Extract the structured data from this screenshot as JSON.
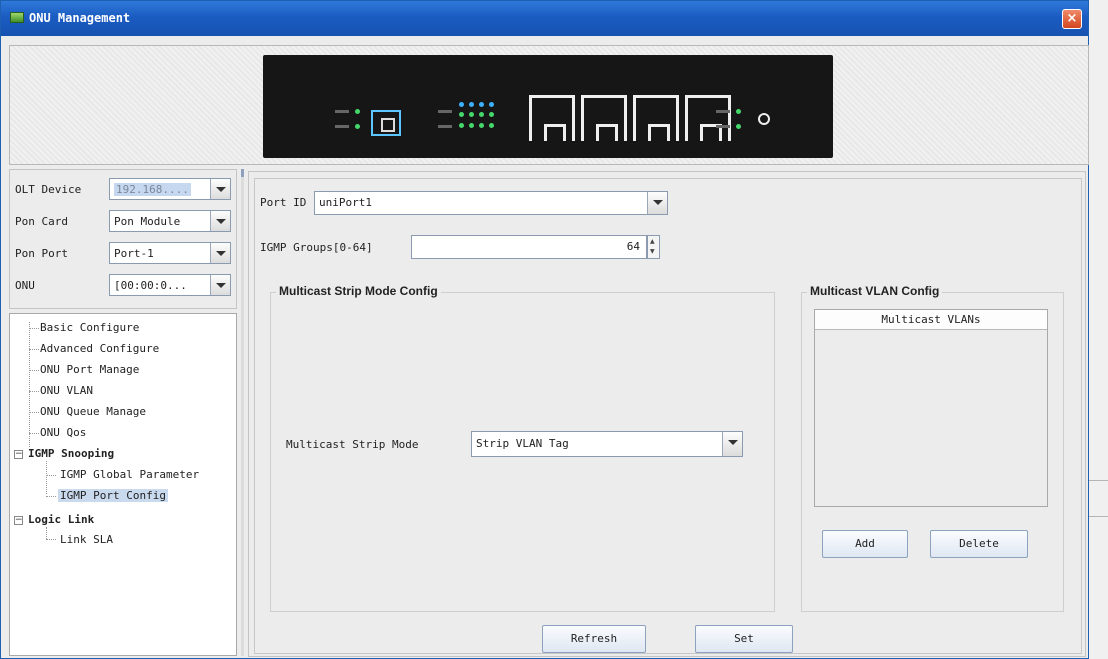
{
  "window": {
    "title": "ONU Management",
    "close_label": "×"
  },
  "left_panel": {
    "fields": [
      {
        "label": "OLT Device",
        "value": "192.168...."
      },
      {
        "label": "Pon Card",
        "value": "Pon Module"
      },
      {
        "label": "Pon Port",
        "value": "Port-1"
      },
      {
        "label": "ONU",
        "value": "[00:00:0..."
      }
    ]
  },
  "tree": {
    "items": [
      {
        "label": "Basic Configure"
      },
      {
        "label": "Advanced Configure"
      },
      {
        "label": "ONU Port Manage"
      },
      {
        "label": "ONU VLAN"
      },
      {
        "label": "ONU Queue Manage"
      },
      {
        "label": "ONU Qos"
      },
      {
        "label": "IGMP Snooping",
        "expanded": true
      },
      {
        "label": "IGMP Global Parameter"
      },
      {
        "label": "IGMP Port Config",
        "selected": true
      },
      {
        "label": "Logic Link",
        "expanded": true
      },
      {
        "label": "Link SLA"
      }
    ]
  },
  "form": {
    "port_id_label": "Port ID",
    "port_id_value": "uniPort1",
    "igmp_groups_label": "IGMP Groups[0-64]",
    "igmp_groups_value": "64",
    "strip_group_title": "Multicast Strip Mode Config",
    "strip_mode_label": "Multicast Strip  Mode",
    "strip_mode_value": "Strip VLAN Tag",
    "vlan_group_title": "Multicast VLAN Config",
    "vlan_table_header": "Multicast VLANs",
    "add_label": "Add",
    "delete_label": "Delete",
    "refresh_label": "Refresh",
    "set_label": "Set"
  },
  "colors": {
    "titlebar": "#1b5cc2",
    "close_button": "#d2461f",
    "tree_selection": "#c9d9ee"
  }
}
